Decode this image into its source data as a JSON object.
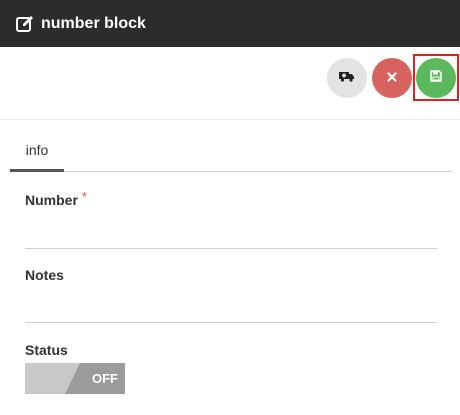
{
  "header": {
    "title": "number block",
    "icon": "edit-icon"
  },
  "toolbar": {
    "transfer_icon": "ambulance-icon",
    "cancel_icon": "close-icon",
    "save_icon": "save-icon",
    "colors": {
      "transfer": "#e3e3e3",
      "cancel": "#d7625e",
      "save": "#5cb85c",
      "highlight": "#e02020"
    }
  },
  "tabs": [
    {
      "label": "info",
      "active": true
    }
  ],
  "form": {
    "number": {
      "label": "Number",
      "required_mark": "*",
      "value": ""
    },
    "notes": {
      "label": "Notes",
      "value": ""
    },
    "status": {
      "label": "Status",
      "toggle_text": "OFF",
      "on": false
    }
  }
}
